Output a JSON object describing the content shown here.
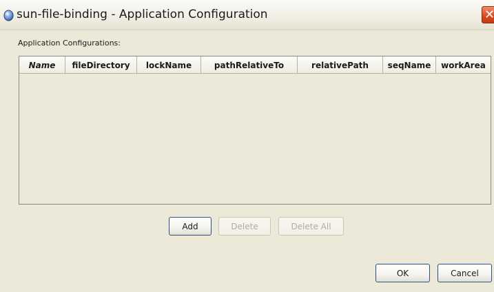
{
  "window": {
    "title": "sun-file-binding - Application Configuration",
    "close_glyph": "✕"
  },
  "section": {
    "label": "Application Configurations:"
  },
  "table": {
    "columns": [
      {
        "label": "Name",
        "italic": true
      },
      {
        "label": "fileDirectory",
        "italic": false
      },
      {
        "label": "lockName",
        "italic": false
      },
      {
        "label": "pathRelativeTo",
        "italic": false
      },
      {
        "label": "relativePath",
        "italic": false
      },
      {
        "label": "seqName",
        "italic": false
      },
      {
        "label": "workArea",
        "italic": false
      }
    ],
    "rows": []
  },
  "actions": {
    "add": "Add",
    "delete": "Delete",
    "delete_all": "Delete All"
  },
  "footer": {
    "ok": "OK",
    "cancel": "Cancel"
  },
  "colors": {
    "dialog_bg": "#ece9d8",
    "close_red": "#d9481f",
    "button_border": "#2d4f86",
    "disabled_text": "#b0aea0"
  },
  "icons": {
    "title": "sphere-icon",
    "close": "close-icon"
  }
}
